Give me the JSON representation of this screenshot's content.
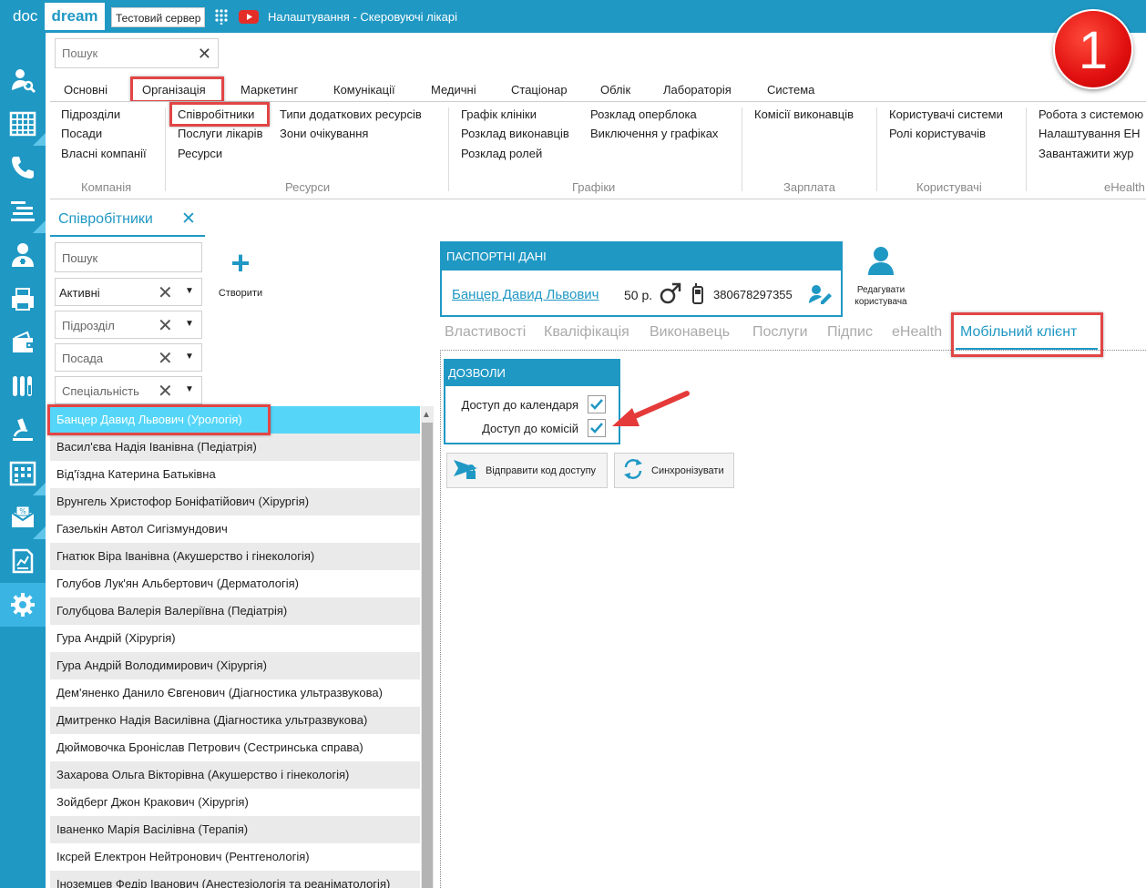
{
  "titlebar": {
    "logo_doc": "doc",
    "logo_dream": "dream",
    "server_badge": "Тестовий сервер",
    "window_title": "Налаштування - Скеровуючі лікарі",
    "step_number": "1"
  },
  "leftnav": {
    "items": [
      "user-search-icon",
      "calendar-grid-icon",
      "phone-icon",
      "reception-desk-icon",
      "doctor-icon",
      "printer-icon",
      "wallet-icon",
      "lab-tubes-icon",
      "microscope-icon",
      "schedule-icon",
      "discount-mail-icon",
      "report-icon",
      "gear-icon"
    ],
    "active": "gear-icon"
  },
  "search": {
    "placeholder": "Пошук"
  },
  "menu": {
    "tabs": [
      "Основні",
      "Організація",
      "Маркетинг",
      "Комунікації",
      "Медичні",
      "Стаціонар",
      "Облік",
      "Лабораторія",
      "Система"
    ],
    "active": "Організація"
  },
  "ribbon": {
    "company": {
      "items": [
        "Підрозділи",
        "Посади",
        "Власні компанії"
      ],
      "group": "Компанія"
    },
    "resources": {
      "col1": [
        "Співробітники",
        "Послуги лікарів",
        "Ресурси"
      ],
      "col2": [
        "Типи додаткових ресурсів",
        "Зони очікування"
      ],
      "group": "Ресурси"
    },
    "schedules": {
      "col1": [
        "Графік клініки",
        "Розклад виконавців",
        "Розклад ролей"
      ],
      "col2": [
        "Розклад оперблока",
        "Виключення у графіках"
      ],
      "group": "Графіки"
    },
    "salary": {
      "items": [
        "Комісії виконавців"
      ],
      "group": "Зарплата"
    },
    "users": {
      "items": [
        "Користувачі системи",
        "Ролі користувачів"
      ],
      "group": "Користувачі"
    },
    "ehealth": {
      "items": [
        "Робота з системою",
        "Налаштування ЕН",
        "Завантажити жур"
      ],
      "group": "eHealth"
    }
  },
  "section_tab": {
    "label": "Співробітники"
  },
  "filters": {
    "search_placeholder": "Пошук",
    "status_value": "Активні",
    "department_placeholder": "Підрозділ",
    "position_placeholder": "Посада",
    "specialty_placeholder": "Спеціальність"
  },
  "create_button": {
    "label": "Створити"
  },
  "employees": [
    "Банцер Давид Львович (Урологія)",
    "Васил'єва Надія Іванівна (Педіатрія)",
    "Від'їздна Катерина Батьківна",
    "Врунгель Христофор Боніфатійович (Хірургія)",
    "Газелькін Автол Сигізмундович",
    "Гнатюк Віра Іванівна (Акушерство і гінекологія)",
    "Голубов Лук'ян Альбертович (Дерматологія)",
    "Голубцова Валерія Валеріївна (Педіатрія)",
    "Гура Андрій (Хірургія)",
    "Гура Андрій Володимирович (Хірургія)",
    "Дем'яненко Данило Євгенович (Діагностика ультразвукова)",
    "Дмитренко Надія Василівна (Діагностика ультразвукова)",
    "Дюймовочка Броніслав Петрович (Сестринська справа)",
    "Захарова Ольга Вікторівна (Акушерство і гінекологія)",
    "Зойдберг Джон Кракович (Хірургія)",
    "Іваненко Марія Васілівна (Терапія)",
    "Ікср​ей Електрон Нейтронович (Рентгенологія)",
    "Іноземцев Федір Іванович (Анестезіологія та реаніматологія)"
  ],
  "passport": {
    "header": "ПАСПОРТНІ ДАНІ",
    "name": "Банцер Давид Львович",
    "age": "50 р.",
    "phone": "380678297355"
  },
  "edit_user": {
    "label_line1": "Редагувати",
    "label_line2": "користувача"
  },
  "detail_tabs": {
    "items": [
      "Властивості",
      "Кваліфікація",
      "Виконавець",
      "Послуги",
      "Підпис",
      "eHealth",
      "Мобільний клієнт"
    ],
    "active": "Мобільний клієнт"
  },
  "permissions": {
    "header": "ДОЗВОЛИ",
    "calendar_access": {
      "label": "Доступ до календаря",
      "checked": true
    },
    "commission_access": {
      "label": "Доступ до комісій",
      "checked": true
    }
  },
  "actions": {
    "send_code": "Відправити код доступу",
    "sync": "Синхронізувати"
  },
  "colors": {
    "brand": "#1f98c4",
    "selection": "#55d6f8",
    "highlight": "#e24545"
  }
}
